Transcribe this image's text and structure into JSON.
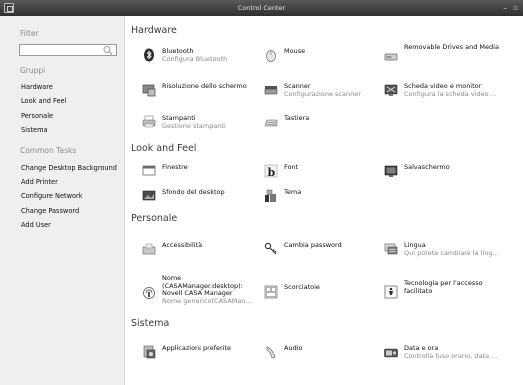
{
  "window": {
    "title": "Control Center",
    "controls": "– ▫"
  },
  "sidebar": {
    "filter_heading": "Filter",
    "filter_value": "",
    "groups_heading": "Gruppi",
    "groups": [
      "Hardware",
      "Look and Feel",
      "Personale",
      "Sistema"
    ],
    "tasks_heading": "Common Tasks",
    "tasks": [
      "Change Desktop Background",
      "Add Printer",
      "Configure Network",
      "Change Password",
      "Add User"
    ]
  },
  "sections": {
    "hardware": {
      "title": "Hardware",
      "items": [
        {
          "name": "Bluetooth",
          "desc": "Configura Bluetooth",
          "icon": "bluetooth-icon"
        },
        {
          "name": "Mouse",
          "desc": "",
          "icon": "mouse-icon"
        },
        {
          "name": "Removable Drives and Media",
          "desc": "",
          "icon": "drive-icon"
        },
        {
          "name": "Risoluzione dello schermo",
          "desc": "",
          "icon": "display-resolution-icon"
        },
        {
          "name": "Scanner",
          "desc": "Configurazione scanner",
          "icon": "scanner-icon"
        },
        {
          "name": "Scheda video e monitor",
          "desc": "Configura la scheda video ...",
          "icon": "video-card-icon"
        },
        {
          "name": "Stampanti",
          "desc": "Gestione stampanti",
          "icon": "printer-icon"
        },
        {
          "name": "Tastiera",
          "desc": "",
          "icon": "keyboard-icon"
        }
      ]
    },
    "look": {
      "title": "Look and Feel",
      "items": [
        {
          "name": "Finestre",
          "desc": "",
          "icon": "windows-icon"
        },
        {
          "name": "Font",
          "desc": "",
          "icon": "font-icon"
        },
        {
          "name": "Salvaschermo",
          "desc": "",
          "icon": "screensaver-icon"
        },
        {
          "name": "Sfondo del desktop",
          "desc": "",
          "icon": "wallpaper-icon"
        },
        {
          "name": "Tema",
          "desc": "",
          "icon": "theme-icon"
        }
      ]
    },
    "personal": {
      "title": "Personale",
      "items": [
        {
          "name": "Accessibilità",
          "desc": "",
          "icon": "accessibility-icon"
        },
        {
          "name": "Cambia password",
          "desc": "",
          "icon": "key-icon"
        },
        {
          "name": "Lingua",
          "desc": "Qui potete cambiare la ling...",
          "icon": "language-icon"
        },
        {
          "name": "Nome (CASAManager.desktop): Novell CASA Manager",
          "desc": "Nome generico(CASAMan...",
          "icon": "casa-manager-icon"
        },
        {
          "name": "Scorciatoie",
          "desc": "",
          "icon": "shortcuts-icon"
        },
        {
          "name": "Tecnologia per l'accesso facilitato",
          "desc": "",
          "icon": "assistive-tech-icon"
        }
      ]
    },
    "system": {
      "title": "Sistema",
      "items": [
        {
          "name": "Applicazioni preferite",
          "desc": "",
          "icon": "preferred-apps-icon"
        },
        {
          "name": "Audio",
          "desc": "",
          "icon": "audio-icon"
        },
        {
          "name": "Data e ora",
          "desc": "Controlla fuso orario, data ...",
          "icon": "date-time-icon"
        }
      ]
    }
  }
}
